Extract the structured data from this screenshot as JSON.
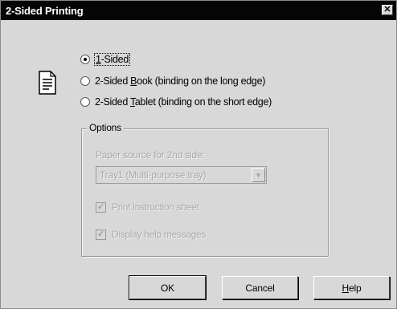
{
  "window": {
    "title": "2-Sided Printing",
    "close_glyph": "✕"
  },
  "icons": {
    "document": "document-icon",
    "close": "close-icon",
    "dropdown": "chevron-down-icon",
    "check": "checkmark-icon"
  },
  "mode": {
    "options": [
      {
        "pre": "",
        "u": "1",
        "post": "-Sided",
        "checked": true
      },
      {
        "pre": "2-Sided ",
        "u": "B",
        "post": "ook (binding on the long edge)",
        "checked": false
      },
      {
        "pre": "2-Sided ",
        "u": "T",
        "post": "ablet (binding on the short edge)",
        "checked": false
      }
    ]
  },
  "options_group": {
    "legend": "Options",
    "paper_source_label": "Paper source for 2nd side:",
    "paper_source_value": "Tray1 (Multi-purpose tray)",
    "print_instruction_label": "Print instruction sheet",
    "print_instruction_checked": true,
    "display_help_label": "Display help messages",
    "display_help_checked": true
  },
  "buttons": {
    "ok": "OK",
    "cancel": "Cancel",
    "help_underlined": "H",
    "help_rest": "elp"
  },
  "colors": {
    "title_bar": "#050505",
    "dialog_bg": "#d8d8d8",
    "disabled_text": "#a8a8a8"
  }
}
